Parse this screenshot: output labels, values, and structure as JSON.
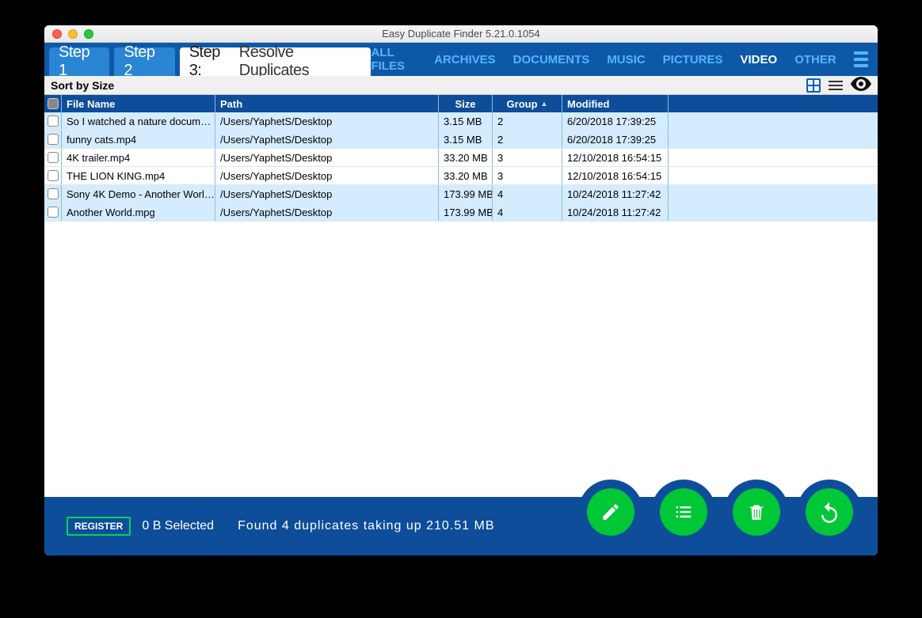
{
  "window_title": "Easy Duplicate Finder 5.21.0.1054",
  "steps": {
    "s1": "Step 1",
    "s2": "Step 2",
    "s3_label": "Step 3:",
    "s3_sub": "Resolve Duplicates"
  },
  "filters": {
    "all": "ALL FILES",
    "arch": "ARCHIVES",
    "docs": "DOCUMENTS",
    "music": "MUSIC",
    "pics": "PICTURES",
    "video": "VIDEO",
    "other": "OTHER"
  },
  "sort_label": "Sort by Size",
  "columns": {
    "name": "File Name",
    "path": "Path",
    "size": "Size",
    "group": "Group",
    "modified": "Modified"
  },
  "rows": [
    {
      "name": "So I watched a nature docum…",
      "path": "/Users/YaphetS/Desktop",
      "size": "3.15 MB",
      "group": "2",
      "mod": "6/20/2018 17:39:25",
      "alt": true
    },
    {
      "name": "funny cats.mp4",
      "path": "/Users/YaphetS/Desktop",
      "size": "3.15 MB",
      "group": "2",
      "mod": "6/20/2018 17:39:25",
      "alt": true
    },
    {
      "name": "4K trailer.mp4",
      "path": "/Users/YaphetS/Desktop",
      "size": "33.20 MB",
      "group": "3",
      "mod": "12/10/2018 16:54:15",
      "alt": false
    },
    {
      "name": "THE LION KING.mp4",
      "path": "/Users/YaphetS/Desktop",
      "size": "33.20 MB",
      "group": "3",
      "mod": "12/10/2018 16:54:15",
      "alt": false
    },
    {
      "name": "Sony 4K Demo - Another Worl…",
      "path": "/Users/YaphetS/Desktop",
      "size": "173.99 MB",
      "group": "4",
      "mod": "10/24/2018 11:27:42",
      "alt": true
    },
    {
      "name": "Another World.mpg",
      "path": "/Users/YaphetS/Desktop",
      "size": "173.99 MB",
      "group": "4",
      "mod": "10/24/2018 11:27:42",
      "alt": true
    }
  ],
  "footer": {
    "register": "REGISTER",
    "selected": "0 B Selected",
    "found": "Found  4  duplicates  taking  up  210.51  MB"
  }
}
